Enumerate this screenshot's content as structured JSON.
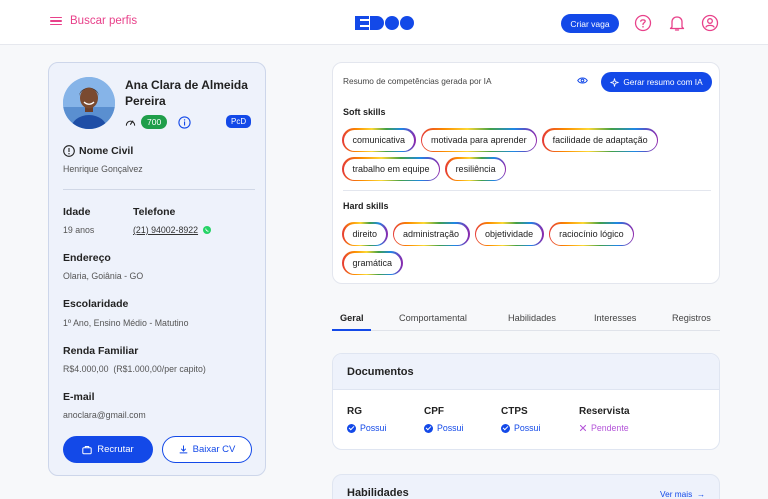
{
  "header": {
    "menu_label": "Buscar perfis",
    "create_job_label": "Criar vaga"
  },
  "profile": {
    "name": "Ana Clara de Almeida Pereira",
    "score": "700",
    "pcd_badge": "PcD",
    "civil_name_label": "Nome Civil",
    "civil_name": "Henrique Gonçalvez",
    "age_label": "Idade",
    "age": "19 anos",
    "phone_label": "Telefone",
    "phone": "(21) 94002-8922",
    "address_label": "Endereço",
    "address": "Olaria, Goiânia - GO",
    "education_label": "Escolaridade",
    "education": "1º Ano, Ensino Médio - Matutino",
    "income_label": "Renda Familiar",
    "income": "R$4.000,00  (R$1.000,00/per capito)",
    "email_label": "E-mail",
    "email": "anoclara@gmail.com",
    "recruit_label": "Recrutar",
    "download_cv_label": "Baixar CV"
  },
  "skills": {
    "title": "Resumo de competências gerada por IA",
    "generate_label": "Gerar resumo com IA",
    "soft_title": "Soft skills",
    "soft": [
      "comunicativa",
      "motivada para aprender",
      "facilidade de adaptação",
      "trabalho em equipe",
      "resiliência"
    ],
    "hard_title": "Hard skills",
    "hard": [
      "direito",
      "administração",
      "objetividade",
      "raciocínio lógico",
      "gramática"
    ]
  },
  "tabs": [
    "Geral",
    "Comportamental",
    "Habilidades",
    "Interesses",
    "Registros"
  ],
  "documents": {
    "title": "Documentos",
    "items": [
      {
        "name": "RG",
        "status": "Possui"
      },
      {
        "name": "CPF",
        "status": "Possui"
      },
      {
        "name": "CTPS",
        "status": "Possui"
      },
      {
        "name": "Reservista",
        "status": "Pendente"
      }
    ]
  },
  "abilities": {
    "title": "Habilidades",
    "see_more": "Ver mais"
  },
  "colors": {
    "brand_blue": "#1349e8",
    "accent_pink": "#e8418a",
    "success_green": "#1f9e4a",
    "pending_purple": "#b455d9"
  }
}
